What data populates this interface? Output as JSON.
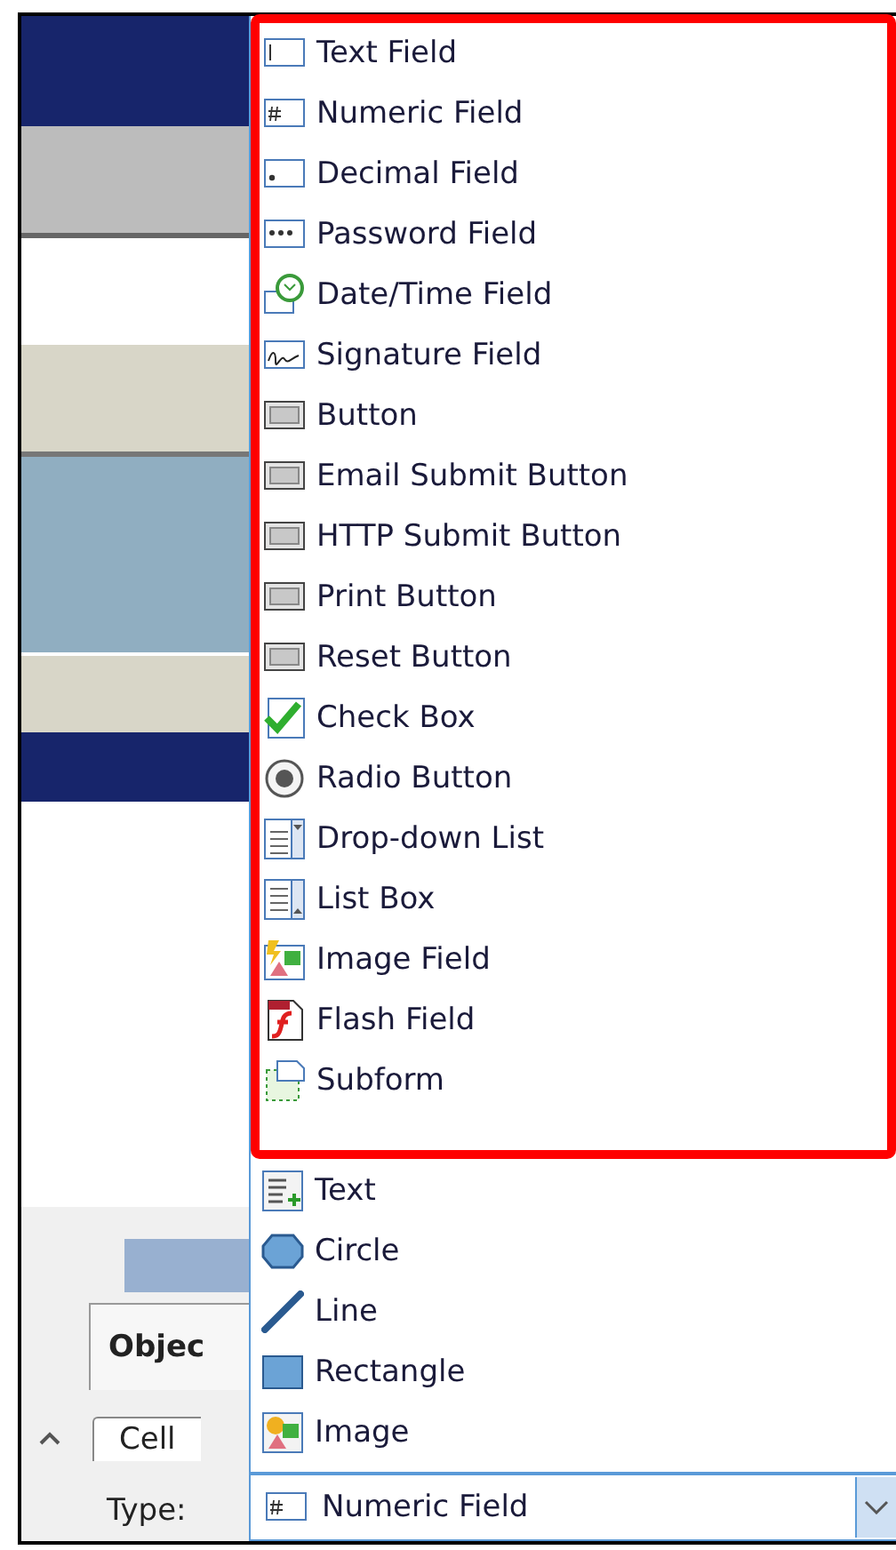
{
  "side_pane": {
    "tabs": [
      {
        "label": "Objec"
      },
      {
        "label": "Cell"
      }
    ],
    "type_label": "Type:"
  },
  "dropdown": {
    "groups": [
      {
        "highlighted": true,
        "items": [
          {
            "label": "Text Field"
          },
          {
            "label": "Numeric Field"
          },
          {
            "label": "Decimal Field"
          },
          {
            "label": "Password Field"
          },
          {
            "label": "Date/Time Field"
          },
          {
            "label": "Signature Field"
          },
          {
            "label": "Button"
          },
          {
            "label": "Email Submit Button"
          },
          {
            "label": "HTTP Submit Button"
          },
          {
            "label": "Print Button"
          },
          {
            "label": "Reset Button"
          },
          {
            "label": "Check Box"
          },
          {
            "label": "Radio Button"
          },
          {
            "label": "Drop-down List"
          },
          {
            "label": "List Box"
          },
          {
            "label": "Image Field"
          },
          {
            "label": "Flash Field"
          },
          {
            "label": "Subform"
          }
        ]
      },
      {
        "highlighted": false,
        "items": [
          {
            "label": "Text"
          },
          {
            "label": "Circle"
          },
          {
            "label": "Line"
          },
          {
            "label": "Rectangle"
          },
          {
            "label": "Image"
          }
        ]
      }
    ]
  },
  "type_combo": {
    "value": "Numeric Field"
  }
}
